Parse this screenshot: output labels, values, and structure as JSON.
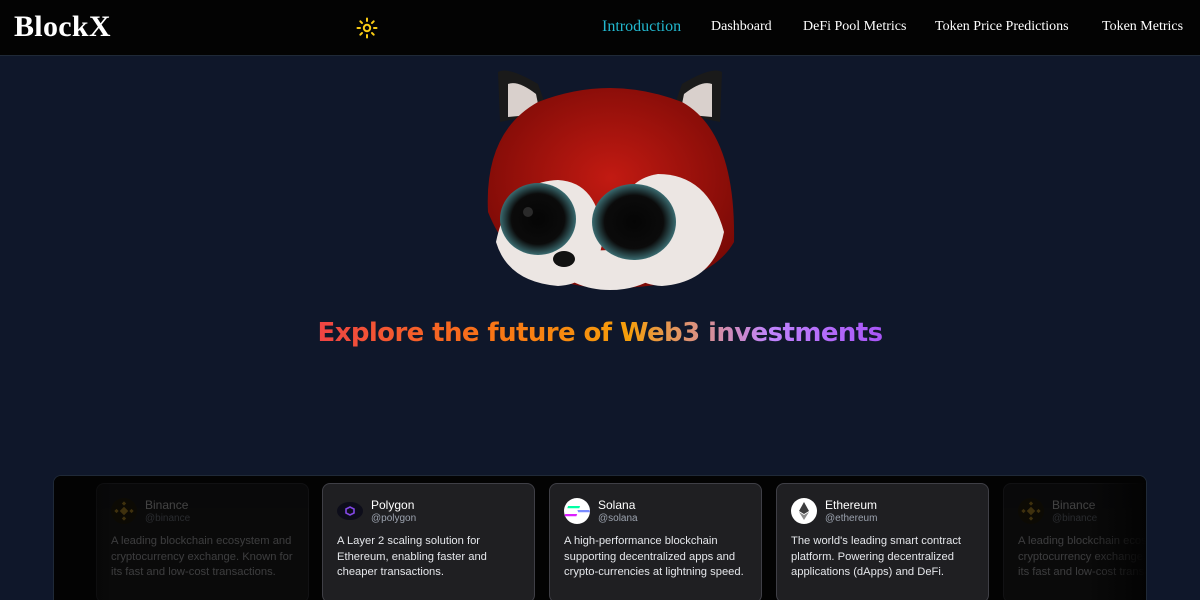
{
  "navbar": {
    "brand": "BlockX",
    "links": [
      {
        "label": "Introduction",
        "active": true
      },
      {
        "label": "Dashboard",
        "active": false
      },
      {
        "label": "DeFi Pool Metrics",
        "active": false
      },
      {
        "label": "Token Price Predictions",
        "active": false
      },
      {
        "label": "Token Metrics",
        "active": false
      }
    ],
    "theme_icon": "sun-icon"
  },
  "hero": {
    "mascot": "fox-mascot",
    "title": "Explore the future of Web3 investments"
  },
  "cards": [
    {
      "name": "Binance",
      "handle": "@binance",
      "icon": "binance-logo-icon",
      "desc": "A leading blockchain ecosystem and cryptocurrency exchange. Known for its fast and low-cost transactions."
    },
    {
      "name": "Polygon",
      "handle": "@polygon",
      "icon": "polygon-logo-icon",
      "desc": "A Layer 2 scaling solution for Ethereum, enabling faster and cheaper transactions."
    },
    {
      "name": "Solana",
      "handle": "@solana",
      "icon": "solana-logo-icon",
      "desc": "A high-performance blockchain supporting decentralized apps and crypto-currencies at lightning speed."
    },
    {
      "name": "Ethereum",
      "handle": "@ethereum",
      "icon": "ethereum-logo-icon",
      "desc": "The world's leading smart contract platform. Powering decentralized applications (dApps) and DeFi."
    },
    {
      "name": "Binance",
      "handle": "@binance",
      "icon": "binance-logo-icon",
      "desc": "A leading blockchain ecosystem and cryptocurrency exchange. Known for its fast and low-cost transactions."
    }
  ],
  "colors": {
    "background": "#0f172a",
    "navbar": "#030303",
    "active_link": "#22b8cf",
    "sun": "#facc15",
    "gradient": [
      "#ef4444",
      "#f97316",
      "#f59e0b",
      "#c084fc",
      "#a855f7"
    ]
  }
}
